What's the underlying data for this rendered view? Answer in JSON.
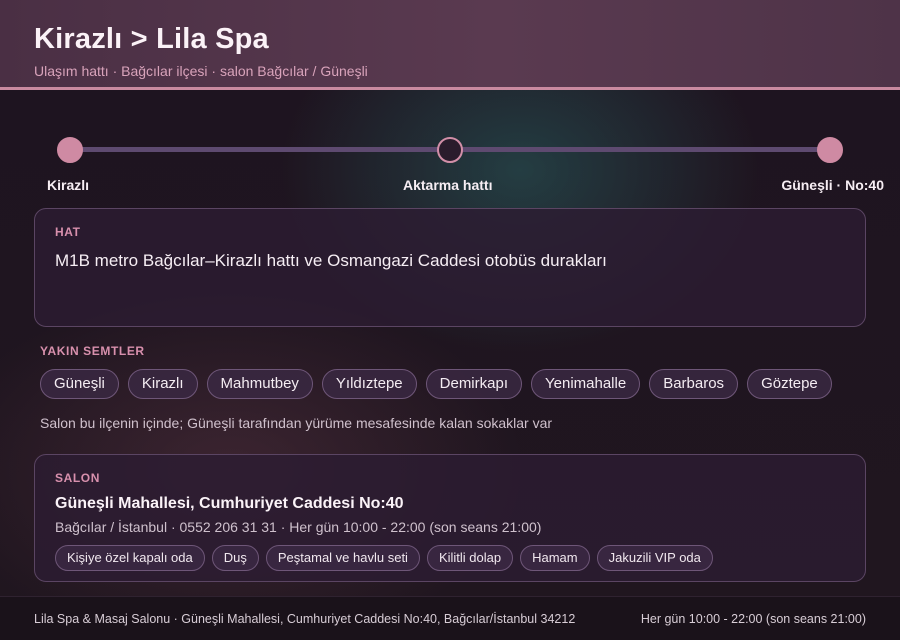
{
  "header": {
    "title": "Kirazlı > Lila Spa",
    "subtitle": "Ulaşım hattı · Bağcılar ilçesi · salon Bağcılar / Güneşli"
  },
  "route": {
    "stops": [
      {
        "label": "Kirazlı"
      },
      {
        "label": "Aktarma hattı"
      },
      {
        "label": "Güneşli · No:40"
      }
    ]
  },
  "hat": {
    "tag": "HAT",
    "text": "M1B metro Bağcılar–Kirazlı hattı ve Osmangazi Caddesi otobüs durakları"
  },
  "nearby": {
    "tag": "YAKIN SEMTLER",
    "items": [
      "Güneşli",
      "Kirazlı",
      "Mahmutbey",
      "Yıldıztepe",
      "Demirkapı",
      "Yenimahalle",
      "Barbaros",
      "Göztepe"
    ],
    "note": "Salon bu ilçenin içinde; Güneşli tarafından yürüme mesafesinde kalan sokaklar var"
  },
  "salon": {
    "tag": "SALON",
    "address": "Güneşli Mahallesi, Cumhuriyet Caddesi No:40",
    "meta": "Bağcılar / İstanbul · 0552 206 31 31 · Her gün 10:00 - 22:00 (son seans 21:00)",
    "features": [
      "Kişiye özel kapalı oda",
      "Duş",
      "Peştamal ve havlu seti",
      "Kilitli dolap",
      "Hamam",
      "Jakuzili VIP oda"
    ]
  },
  "footer": {
    "left": "Lila Spa & Masaj Salonu · Güneşli Mahallesi, Cumhuriyet Caddesi No:40, Bağcılar/İstanbul 34212",
    "right": "Her gün 10:00 - 22:00 (son seans 21:00)"
  },
  "colors": {
    "accent": "#d890ad",
    "header_bg": "#5a3a50",
    "track": "#5e4a70"
  }
}
